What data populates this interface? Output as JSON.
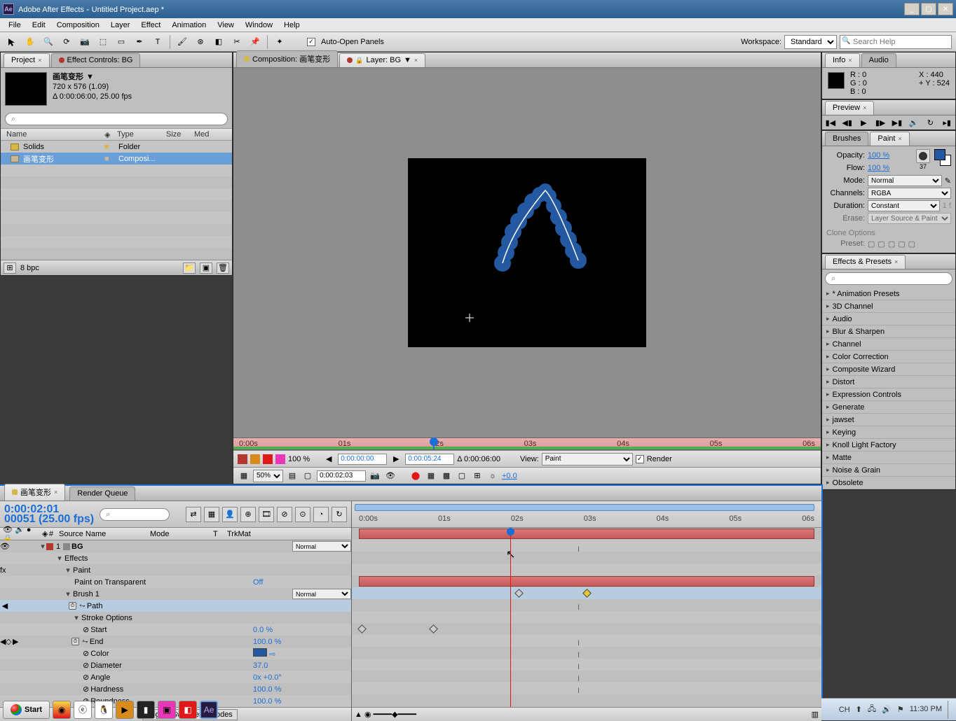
{
  "titlebar": {
    "app": "Adobe After Effects",
    "project": "Untitled Project.aep *"
  },
  "menu": [
    "File",
    "Edit",
    "Composition",
    "Layer",
    "Effect",
    "Animation",
    "View",
    "Window",
    "Help"
  ],
  "toolbar": {
    "auto_open": "Auto-Open Panels",
    "workspace_label": "Workspace:",
    "workspace_value": "Standard",
    "search_placeholder": "Search Help"
  },
  "project": {
    "tab_project": "Project",
    "tab_effect": "Effect Controls: BG",
    "comp_name": "画笔变形",
    "dims": "720 x 576 (1.09)",
    "dur_fps": "Δ 0:00:06:00, 25.00 fps",
    "cols": {
      "name": "Name",
      "type": "Type",
      "size": "Size"
    },
    "row_solids": "Solids",
    "row_solids_type": "Folder",
    "row_comp": "画笔变形",
    "row_comp_type": "Composi...",
    "bpc": "8 bpc"
  },
  "viewer": {
    "tab_comp": "Composition: 画笔变形",
    "tab_layer": "Layer: BG",
    "ticks": [
      "0:00s",
      "01s",
      "02s",
      "03s",
      "04s",
      "05s",
      "06s"
    ],
    "pct_label": "100 %",
    "tc_in": "0:00:00:00",
    "tc_out": "0:00:05:24",
    "tc_dur": "Δ 0:00:06:00",
    "view_label": "View:",
    "view_value": "Paint",
    "render": "Render",
    "zoom": "50%",
    "tc_current": "0:00:02:03",
    "plus0": "+0.0"
  },
  "info": {
    "tab_info": "Info",
    "tab_audio": "Audio",
    "r": "R : 0",
    "g": "G : 0",
    "b": "B : 0",
    "x": "X : 440",
    "y": "Y : 524"
  },
  "preview": {
    "tab": "Preview"
  },
  "paint": {
    "tab_brushes": "Brushes",
    "tab_paint": "Paint",
    "opacity_l": "Opacity:",
    "opacity_v": "100 %",
    "flow_l": "Flow:",
    "flow_v": "100 %",
    "brush_num": "37",
    "mode_l": "Mode:",
    "mode_v": "Normal",
    "channels_l": "Channels:",
    "channels_v": "RGBA",
    "duration_l": "Duration:",
    "duration_v": "Constant",
    "duration_frames": "1 f",
    "erase_l": "Erase:",
    "erase_v": "Layer Source & Paint",
    "clone_l": "Clone Options",
    "preset_l": "Preset:"
  },
  "effects": {
    "tab": "Effects & Presets",
    "items": [
      "* Animation Presets",
      "3D Channel",
      "Audio",
      "Blur & Sharpen",
      "Channel",
      "Color Correction",
      "Composite Wizard",
      "Distort",
      "Expression Controls",
      "Generate",
      "jawset",
      "Keying",
      "Knoll Light Factory",
      "Matte",
      "Noise & Grain",
      "Obsolete"
    ]
  },
  "timeline": {
    "tab_comp": "画笔变形",
    "tab_rq": "Render Queue",
    "timecode": "0:00:02:01",
    "sub_tc": "00051 (25.00 fps)",
    "col_num": "#",
    "col_src": "Source Name",
    "col_mode": "Mode",
    "col_t": "T",
    "col_trk": "TrkMat",
    "ticks": [
      "0:00s",
      "01s",
      "02s",
      "03s",
      "04s",
      "05s",
      "06s"
    ],
    "layer_num": "1",
    "layer_name": "BG",
    "layer_mode": "Normal",
    "effects_l": "Effects",
    "paint_l": "Paint",
    "pot_l": "Paint on Transparent",
    "pot_v": "Off",
    "brush_l": "Brush 1",
    "brush_mode": "Normal",
    "path_l": "Path",
    "stroke_l": "Stroke Options",
    "start_l": "Start",
    "start_v": "0.0 %",
    "end_l": "End",
    "end_v": "100.0 %",
    "color_l": "Color",
    "diam_l": "Diameter",
    "diam_v": "37.0",
    "angle_l": "Angle",
    "angle_v": "0x +0.0°",
    "hard_l": "Hardness",
    "hard_v": "100.0 %",
    "round_l": "Roundness",
    "round_v": "100.0 %",
    "toggle": "Toggle Switches / Modes"
  },
  "taskbar": {
    "start": "Start",
    "lang": "CH",
    "time": "11:30 PM"
  }
}
